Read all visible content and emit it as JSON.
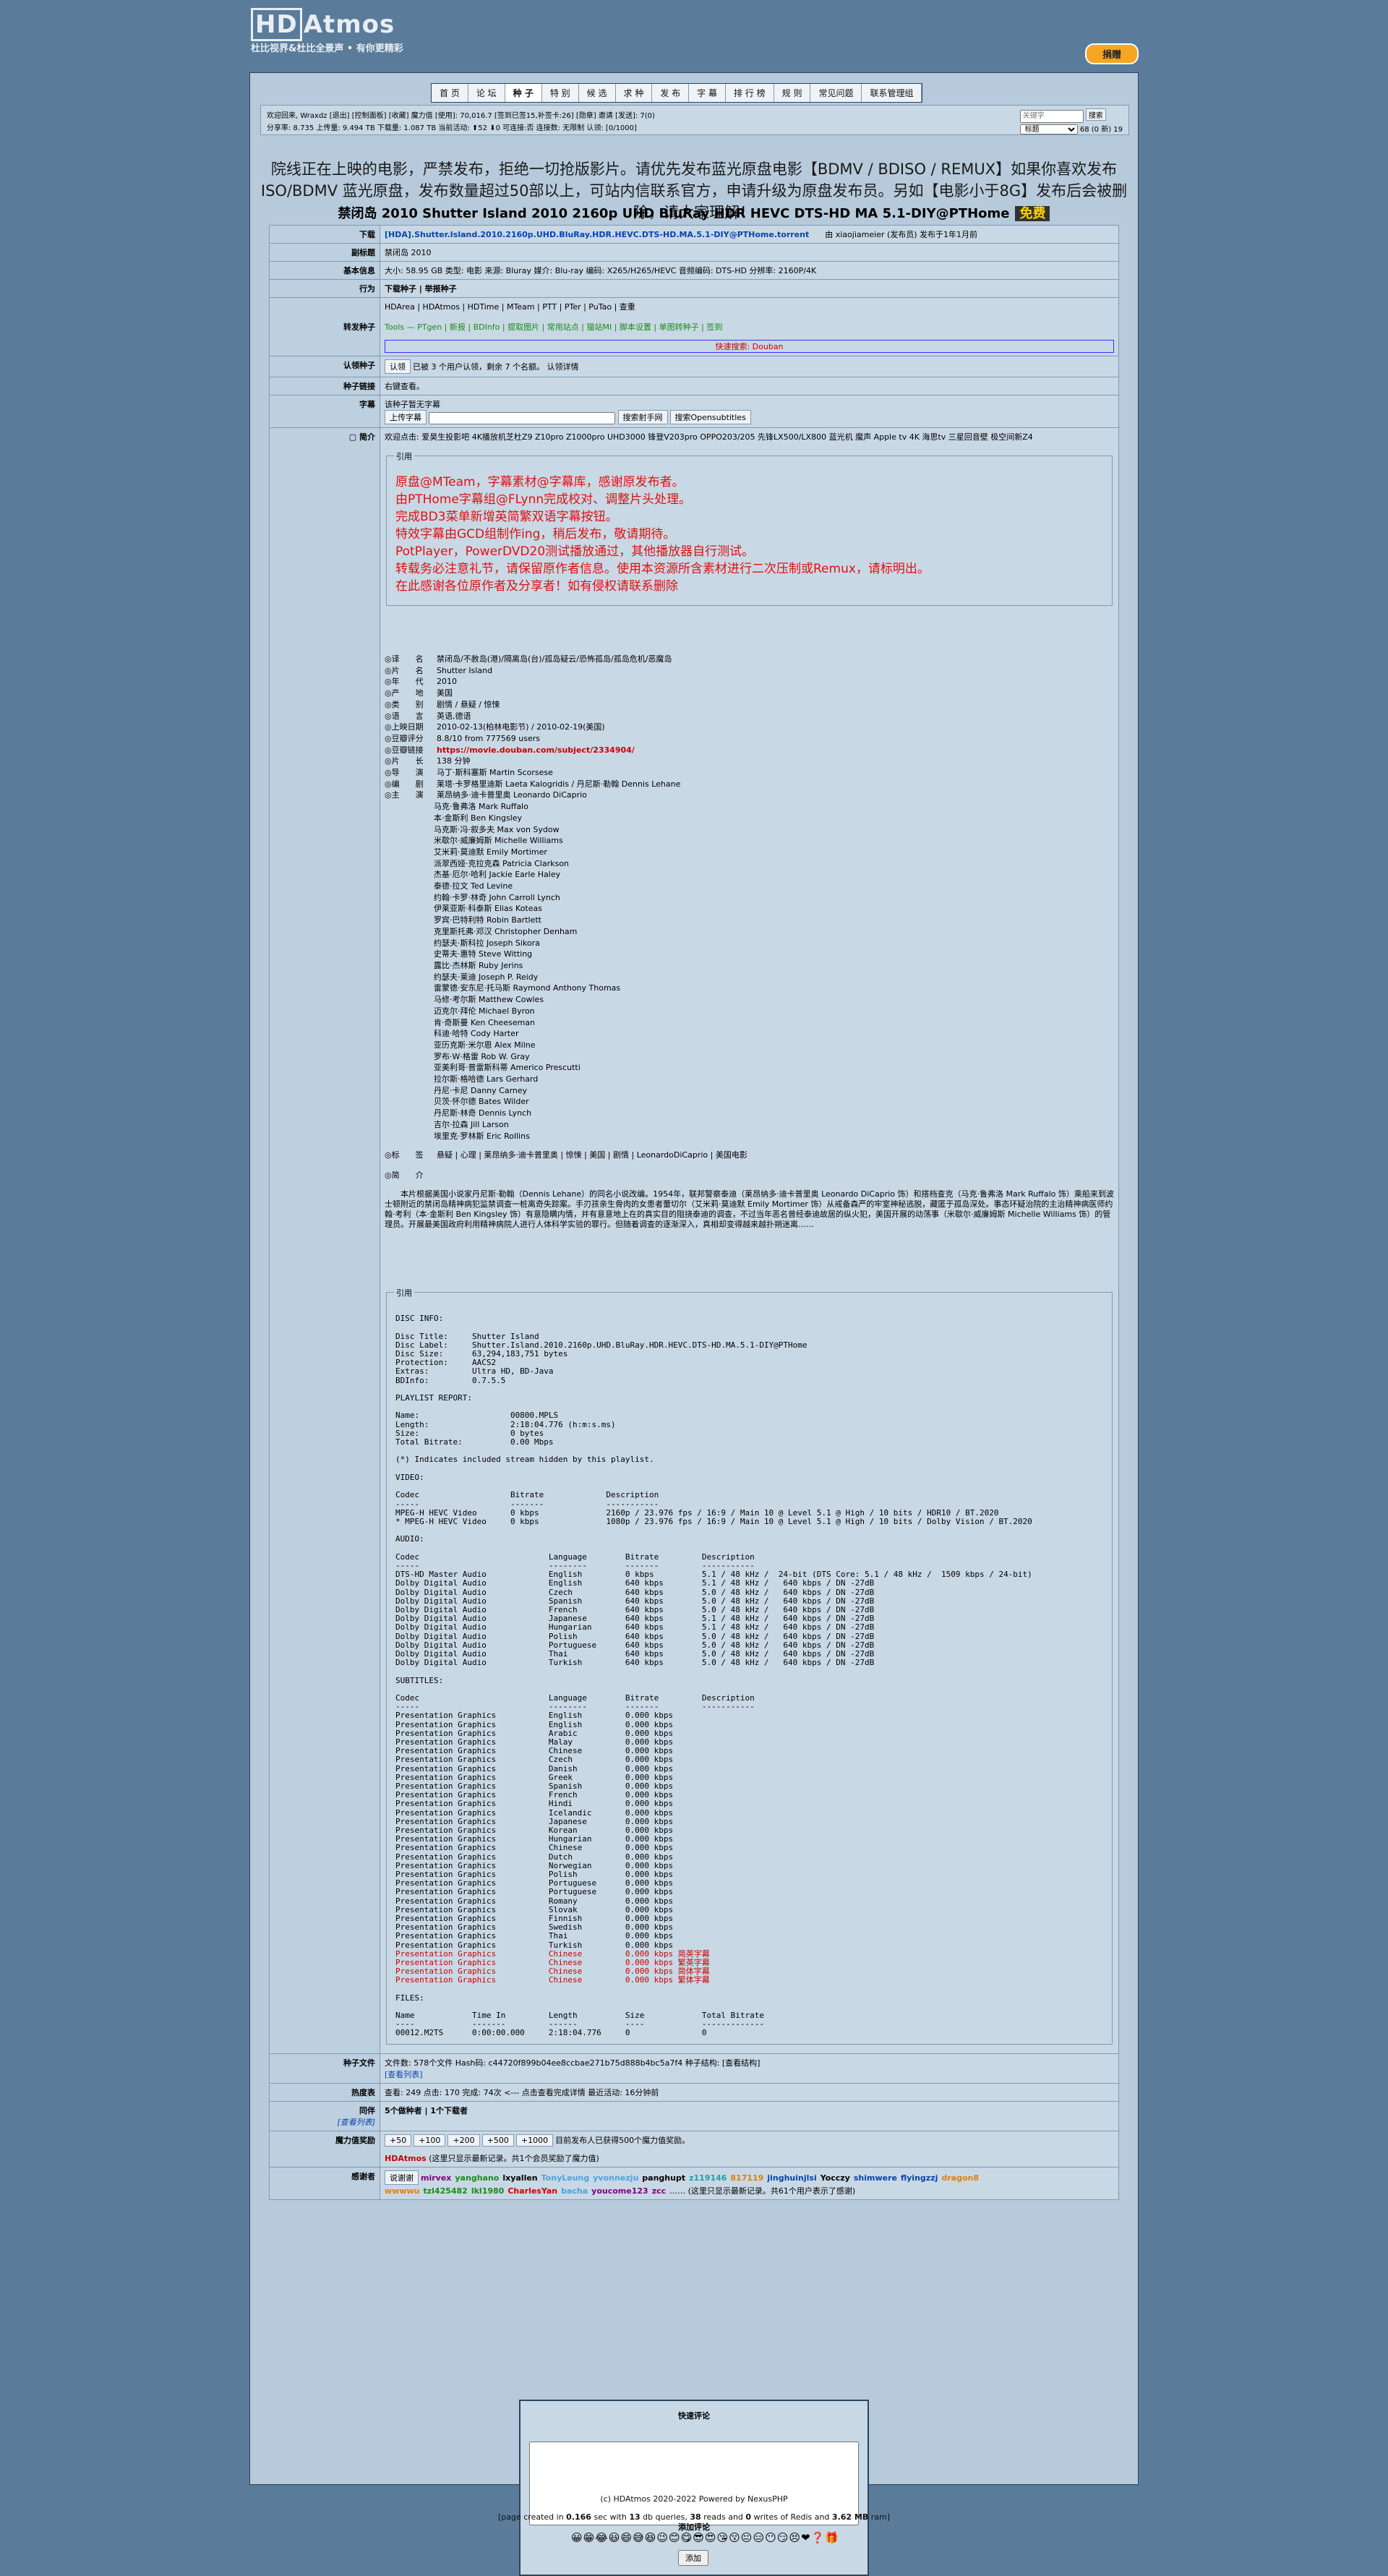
{
  "brand": {
    "name": "HDAtmos",
    "tagline": "杜比视界&杜比全景声 • 有你更精彩"
  },
  "donate_label": "捐赠",
  "nav": [
    "首 页",
    "论 坛",
    "种 子",
    "特 别",
    "候 选",
    "求 种",
    "发 布",
    "字 幕",
    "排 行 榜",
    "规 则",
    "常见问题",
    "联系管理组"
  ],
  "userinfo": {
    "line1": "欢迎回来, Wraxdz [退出] [控制面板] [收藏] 魔力值 [使用]: 70,016.7 [签到已签15,补签卡:26] [勋章] 邀请 [发送]: 7(0)",
    "line2": "分享率: 8.735 上传量: 9.494 TB 下载量: 1.087 TB 当前活动: ⬆52 ⬇0   可连接:否 连接数: 无限制 认领: [0/1000]",
    "search_placeholder": "关键字",
    "search_button": "搜索",
    "select_value": "标题",
    "msg": "68 (0 新)  19"
  },
  "notice": "院线正在上映的电影，严禁发布，拒绝一切抢版影片。请优先发布蓝光原盘电影【BDMV / BDISO / REMUX】如果你喜欢发布ISO/BDMV 蓝光原盘，发布数量超过50部以上，可站内信联系官方，申请升级为原盘发布员。另如【电影小于8G】发布后会被删除，请大家理解！",
  "title": "禁闭岛 2010 Shutter Island 2010 2160p UHD BluRay HDR HEVC DTS-HD MA 5.1-DIY@PTHome",
  "free_tag": "免费",
  "rows": {
    "download": {
      "label": "下载",
      "file": "[HDA].Shutter.Island.2010.2160p.UHD.BluRay.HDR.HEVC.DTS-HD.MA.5.1-DIY@PTHome.torrent",
      "by": "由 xiaojiameier (发布员) 发布于1年1月前"
    },
    "subtitle": {
      "label": "副标题",
      "value": "禁闭岛 2010"
    },
    "basic": {
      "label": "基本信息",
      "value": "大小: 58.95 GB   类型: 电影   来源: Bluray   媒介: Blu-ray   编码: X265/H265/HEVC   音频编码: DTS-HD   分辨率: 2160P/4K"
    },
    "action": {
      "label": "行为",
      "value": "下载种子 | 举报种子"
    },
    "related": {
      "label": "转发种子",
      "sites": "HDArea | HDAtmos | HDTime | MTeam | PTT | PTer | PuTao | 查重",
      "tools": "Tools — PTgen | 新报 | BDInfo | 提取图片 | 常用站点 | 猫站MI | 脚本设置 | 单图转种子 | 签到",
      "quick": "快速搜索: Douban"
    },
    "claim": {
      "label": "认领种子",
      "button": "认领",
      "text": "已被 3 个用户认领，剩余 7 个名额。 认领详情"
    },
    "link": {
      "label": "种子链接",
      "value": "右键查看。"
    },
    "subs": {
      "label": "字幕",
      "none": "该种子暂无字幕",
      "upload": "上传字幕",
      "search1": "搜索射手网",
      "search2": "搜索Opensubtitles"
    },
    "intro_label": "简介",
    "intro_top": "欢迎点击: 爱昊生投影吧 4K播放机芝杜Z9 Z10pro Z1000pro UHD3000 锋登V203pro OPPO203/205 先锋LX500/LX800 蓝光机 魔声 Apple tv 4K 海思tv 三星回音壁 极空间新Z4",
    "quote_label": "引用",
    "quote_lines": [
      "原盘@MTeam，字幕素材@字幕库，感谢原发布者。",
      "由PTHome字幕组@FLynn完成校对、调整片头处理。",
      "完成BD3菜单新增英简繁双语字幕按钮。",
      "特效字幕由GCD组制作ing，稍后发布，敬请期待。",
      "PotPlayer，PowerDVD20测试播放通过，其他播放器自行测试。",
      "转载务必注意礼节，请保留原作者信息。使用本资源所含素材进行二次压制或Remux，请标明出。",
      "在此感谢各位原作者及分享者！如有侵权请联系删除"
    ],
    "fields": [
      [
        "◎译　　名",
        "禁闭岛/不赦岛(港)/隔离岛(台)/孤岛疑云/恐怖孤岛/孤岛危机/恶魔岛"
      ],
      [
        "◎片　　名",
        "Shutter Island"
      ],
      [
        "◎年　　代",
        "2010"
      ],
      [
        "◎产　　地",
        "美国"
      ],
      [
        "◎类　　别",
        "剧情 / 悬疑 / 惊悚"
      ],
      [
        "◎语　　言",
        "英语,德语"
      ],
      [
        "◎上映日期",
        "2010-02-13(柏林电影节) / 2010-02-19(美国)"
      ],
      [
        "◎豆瓣评分",
        "8.8/10 from 777569 users"
      ],
      [
        "◎豆瓣链接",
        "https://movie.douban.com/subject/2334904/"
      ],
      [
        "◎片　　长",
        "138 分钟"
      ],
      [
        "◎导　　演",
        "马丁·斯科塞斯 Martin Scorsese"
      ],
      [
        "◎编　　剧",
        "莱塔·卡罗格里迪斯 Laeta Kalogridis / 丹尼斯·勒翰 Dennis Lehane"
      ],
      [
        "◎主　　演",
        "莱昂纳多·迪卡普里奥 Leonardo DiCaprio"
      ]
    ],
    "cast": [
      "马克·鲁弗洛 Mark Ruffalo",
      "本·金斯利 Ben Kingsley",
      "马克斯·冯·叙多夫 Max von Sydow",
      "米歇尔·威廉姆斯 Michelle Williams",
      "艾米莉·莫迪默 Emily Mortimer",
      "派翠西娅·克拉克森 Patricia Clarkson",
      "杰基·厄尔·哈利 Jackie Earle Haley",
      "泰德·拉文 Ted Levine",
      "约翰·卡罗·林奇 John Carroll Lynch",
      "伊莱亚斯·科泰斯 Elias Koteas",
      "罗宾·巴特利特 Robin Bartlett",
      "克里斯托弗·邓汉 Christopher Denham",
      "约瑟夫·斯科拉 Joseph Sikora",
      "史蒂夫·惠特 Steve Witting",
      "露比·杰林斯 Ruby Jerins",
      "约瑟夫·莱迪 Joseph P. Reidy",
      "雷蒙德·安东尼·托马斯 Raymond Anthony Thomas",
      "马修·考尔斯 Matthew Cowles",
      "迈克尔·拜伦 Michael Byron",
      "肯·奇斯曼 Ken Cheeseman",
      "科迪·哈特 Cody Harter",
      "亚历克斯·米尔恩 Alex Milne",
      "罗布·W·格雷 Rob W. Gray",
      "亚美利哥·普雷斯科蒂 Americo Prescutti",
      "拉尔斯·格哈德 Lars Gerhard",
      "丹尼·卡尼 Danny Carney",
      "贝茨·怀尔德 Bates Wilder",
      "丹尼斯·林奇 Dennis Lynch",
      "吉尔·拉森 Jill Larson",
      "埃里克·罗林斯 Eric Rollins"
    ],
    "tags": [
      "◎标　　签",
      "悬疑 | 心理 | 莱昂纳多·迪卡普里奥 | 惊悚 | 美国 | 剧情 | LeonardoDiCaprio | 美国电影"
    ],
    "synopsis_label": "◎简　　介",
    "synopsis": "　　本片根据美国小说家丹尼斯·勒翰（Dennis Lehane）的同名小说改编。1954年，联邦警察泰迪（莱昂纳多·迪卡普里奥 Leonardo DiCaprio 饰）和搭档查克（马克·鲁弗洛 Mark Ruffalo 饰）乘船来到波士顿附近的禁闭岛精神病犯监禁调查一桩离奇失踪案。手刃孩亲生骨肉的女患者蕾切尔（艾米莉·莫迪默 Emily Mortimer 饰）从戒备森严的牢室神秘逃脱，藏匿于孤岛深处。事态环疑治院的主治精神病医师约翰·考利（本·金斯利 Ben Kingsley 饰）有意隐瞒内情，并有意意地上在的真实目的阻挠泰迪的调查，不过当年恶名曾经泰迪故居的纵火犯，美国开展的动荡事（米歇尔·威廉姆斯 Michelle Williams 饰）的管理员。开展最美国政府利用精神病院人进行人体科学实验的罪行。但随着调查的逐渐深入，真相却变得越来越扑朔迷离……",
    "quote2_label": "引用",
    "bdinfo": "DISC INFO:\n\nDisc Title:     Shutter Island\nDisc Label:     Shutter.Island.2010.2160p.UHD.BluRay.HDR.HEVC.DTS-HD.MA.5.1-DIY@PTHome\nDisc Size:      63,294,183,751 bytes\nProtection:     AACS2\nExtras:         Ultra HD, BD-Java\nBDInfo:         0.7.5.5\n\nPLAYLIST REPORT:\n\nName:                   00800.MPLS\nLength:                 2:18:04.776 (h:m:s.ms)\nSize:                   0 bytes\nTotal Bitrate:          0.00 Mbps\n\n(*) Indicates included stream hidden by this playlist.\n\nVIDEO:\n\nCodec                   Bitrate             Description\n-----                   -------             -----------\nMPEG-H HEVC Video       0 kbps              2160p / 23.976 fps / 16:9 / Main 10 @ Level 5.1 @ High / 10 bits / HDR10 / BT.2020\n* MPEG-H HEVC Video     0 kbps              1080p / 23.976 fps / 16:9 / Main 10 @ Level 5.1 @ High / 10 bits / Dolby Vision / BT.2020\n\nAUDIO:\n\nCodec                           Language        Bitrate         Description\n-----                           --------        -------         -----------\nDTS-HD Master Audio             English         0 kbps          5.1 / 48 kHz /  24-bit (DTS Core: 5.1 / 48 kHz /  1509 kbps / 24-bit)\nDolby Digital Audio             English         640 kbps        5.1 / 48 kHz /   640 kbps / DN -27dB\nDolby Digital Audio             Czech           640 kbps        5.0 / 48 kHz /   640 kbps / DN -27dB\nDolby Digital Audio             Spanish         640 kbps        5.0 / 48 kHz /   640 kbps / DN -27dB\nDolby Digital Audio             French          640 kbps        5.0 / 48 kHz /   640 kbps / DN -27dB\nDolby Digital Audio             Japanese        640 kbps        5.1 / 48 kHz /   640 kbps / DN -27dB\nDolby Digital Audio             Hungarian       640 kbps        5.1 / 48 kHz /   640 kbps / DN -27dB\nDolby Digital Audio             Polish          640 kbps        5.0 / 48 kHz /   640 kbps / DN -27dB\nDolby Digital Audio             Portuguese      640 kbps        5.0 / 48 kHz /   640 kbps / DN -27dB\nDolby Digital Audio             Thai            640 kbps        5.0 / 48 kHz /   640 kbps / DN -27dB\nDolby Digital Audio             Turkish         640 kbps        5.0 / 48 kHz /   640 kbps / DN -27dB\n\nSUBTITLES:\n\nCodec                           Language        Bitrate         Description\n-----                           --------        -------         -----------\nPresentation Graphics           English         0.000 kbps\nPresentation Graphics           English         0.000 kbps\nPresentation Graphics           Arabic          0.000 kbps\nPresentation Graphics           Malay           0.000 kbps\nPresentation Graphics           Chinese         0.000 kbps\nPresentation Graphics           Czech           0.000 kbps\nPresentation Graphics           Danish          0.000 kbps\nPresentation Graphics           Greek           0.000 kbps\nPresentation Graphics           Spanish         0.000 kbps\nPresentation Graphics           French          0.000 kbps\nPresentation Graphics           Hindi           0.000 kbps\nPresentation Graphics           Icelandic       0.000 kbps\nPresentation Graphics           Japanese        0.000 kbps\nPresentation Graphics           Korean          0.000 kbps\nPresentation Graphics           Hungarian       0.000 kbps\nPresentation Graphics           Chinese         0.000 kbps\nPresentation Graphics           Dutch           0.000 kbps\nPresentation Graphics           Norwegian       0.000 kbps\nPresentation Graphics           Polish          0.000 kbps\nPresentation Graphics           Portuguese      0.000 kbps\nPresentation Graphics           Portuguese      0.000 kbps\nPresentation Graphics           Romany          0.000 kbps\nPresentation Graphics           Slovak          0.000 kbps\nPresentation Graphics           Finnish         0.000 kbps\nPresentation Graphics           Swedish         0.000 kbps\nPresentation Graphics           Thai            0.000 kbps\nPresentation Graphics           Turkish         0.000 kbps",
    "bdinfo_red": "Presentation Graphics           Chinese         0.000 kbps 简英字幕\nPresentation Graphics           Chinese         0.000 kbps 繁英字幕\nPresentation Graphics           Chinese         0.000 kbps 简体字幕\nPresentation Graphics           Chinese         0.000 kbps 繁体字幕",
    "bdinfo_files": "FILES:\n\nName            Time In         Length          Size            Total Bitrate\n----            -------         ------          ----            -------------\n00012.M2TS      0:00:00.000     2:18:04.776     0               0",
    "files": {
      "label": "种子文件",
      "value": "文件数: 578个文件     Hash码: c44720f899b04ee8ccbae271b75d888b4bc5a7f4     种子结构: [查看结构]",
      "list": "[查看列表]"
    },
    "hot": {
      "label": "热度表",
      "value": "查看: 249   点击: 170   完成: 74次 <--- 点击查看完成详情     最近活动: 16分钟前"
    },
    "peers": {
      "label": "同伴",
      "sub": "[查看列表]",
      "value": "5个做种者 | 1个下载者"
    },
    "bonus": {
      "label": "魔力值奖励",
      "buttons": [
        "+50",
        "+100",
        "+200",
        "+500",
        "+1000"
      ],
      "note": "目前发布人已获得500个魔力值奖励。",
      "site": "HDAtmos",
      "note2": "(这里只显示最新记录。共1个会员奖励了魔力值)"
    },
    "thanks": {
      "label": "感谢者",
      "button": "说谢谢",
      "users": [
        "mirvex",
        "yanghano",
        "lxyallen",
        "TonyLeung",
        "yvonnezju",
        "panghupt",
        "z119146",
        "817119",
        "jinghuinjlsi",
        "Yocczy",
        "shimwere",
        "flyingzzj",
        "dragon8 wwwwu",
        "tzl425482",
        "lkl1980",
        "CharlesYan",
        "bacha",
        "youcome123",
        "zcc"
      ],
      "note": "…… (这里只显示最新记录。共61个用户表示了感谢)"
    }
  },
  "quick_comment": {
    "title": "快速评论",
    "button": "添加",
    "link": "添加评论"
  },
  "footer": {
    "line1": "(c) HDAtmos 2020-2022 Powered by NexusPHP",
    "line2_a": "[page created in ",
    "t": "0.166",
    "line2_b": " sec with ",
    "q": "13",
    "line2_c": " db queries, ",
    "r": "38",
    "line2_d": " reads and ",
    "w": "0",
    "line2_e": " writes of Redis and ",
    "m": "3.62 MB",
    "line2_f": " ram]"
  }
}
